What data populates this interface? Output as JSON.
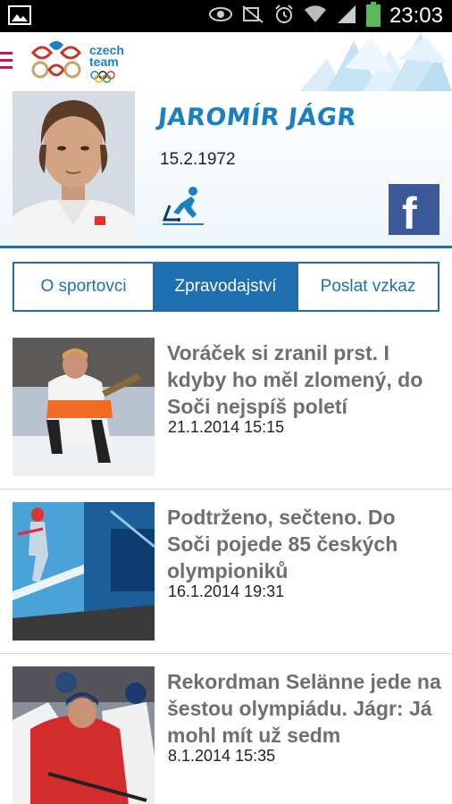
{
  "status_bar": {
    "time": "23:03",
    "icons": [
      "gallery-icon",
      "eye-icon",
      "mute-icon",
      "alarm-icon",
      "wifi-icon",
      "signal-icon",
      "battery-icon"
    ]
  },
  "header": {
    "logo_text_line1": "czech",
    "logo_text_line2": "team",
    "menu_icon": "menu-icon"
  },
  "athlete": {
    "name": "JAROMÍR JÁGR",
    "birth_date": "15.2.1972",
    "sport_icon": "ice-hockey-icon",
    "share_icon": "facebook-icon"
  },
  "tabs": [
    {
      "label": "O sportovci",
      "active": false
    },
    {
      "label": "Zpravodajství",
      "active": true
    },
    {
      "label": "Poslat vzkaz",
      "active": false
    }
  ],
  "news": [
    {
      "title": "Voráček si zranil prst. I kdyby ho měl zlomený, do Soči nejspíš poletí",
      "date": "21.1.2014 15:15"
    },
    {
      "title": "Podtrženo, sečteno. Do Soči pojede 85 českých olympioniků",
      "date": "16.1.2014 19:31"
    },
    {
      "title": "Rekordman Selänne jede na šestou olympiádu. Jágr: Já mohl mít už sedm",
      "date": "8.1.2014 15:35"
    }
  ],
  "colors": {
    "accent_blue": "#1e6fb0",
    "name_blue": "#1b7fc3",
    "facebook": "#3b5998",
    "menu_pink": "#c2185b"
  }
}
